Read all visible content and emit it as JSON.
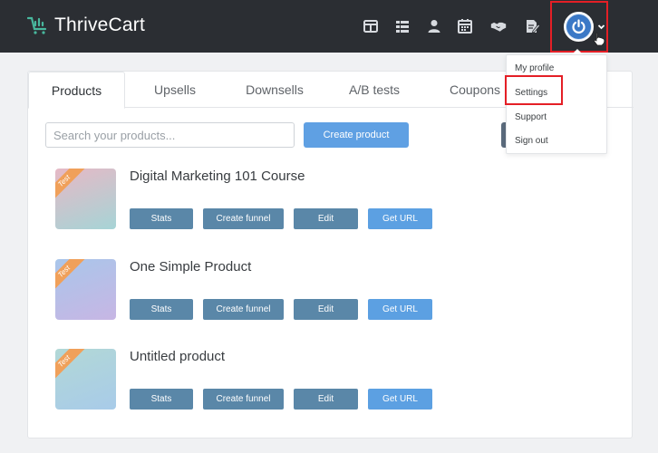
{
  "header": {
    "brand": "ThriveCart",
    "nav_icons": [
      "layout-icon",
      "list-icon",
      "user-icon",
      "calendar-icon",
      "handshake-icon",
      "edit-document-icon"
    ],
    "accent_color": "#3a78c6"
  },
  "tabs": [
    {
      "label": "Products",
      "active": true
    },
    {
      "label": "Upsells",
      "active": false
    },
    {
      "label": "Downsells",
      "active": false
    },
    {
      "label": "A/B tests",
      "active": false
    },
    {
      "label": "Coupons",
      "active": false
    }
  ],
  "search": {
    "placeholder": "Search your products..."
  },
  "create_button": "Create product",
  "products": [
    {
      "name": "Digital Marketing 101 Course",
      "badge": "Test",
      "thumb_colors": [
        "#e6b9c6",
        "#a6d4d6"
      ]
    },
    {
      "name": "One Simple Product",
      "badge": "Test",
      "thumb_colors": [
        "#a9c6ea",
        "#c7b6e4"
      ]
    },
    {
      "name": "Untitled product",
      "badge": "Test",
      "thumb_colors": [
        "#b2d8d6",
        "#a8cbe9"
      ]
    }
  ],
  "product_actions": {
    "stats": "Stats",
    "create_funnel": "Create funnel",
    "edit": "Edit",
    "get_url": "Get URL"
  },
  "user_menu": {
    "items": [
      "My profile",
      "Settings",
      "Support",
      "Sign out"
    ],
    "highlighted": "Settings"
  }
}
